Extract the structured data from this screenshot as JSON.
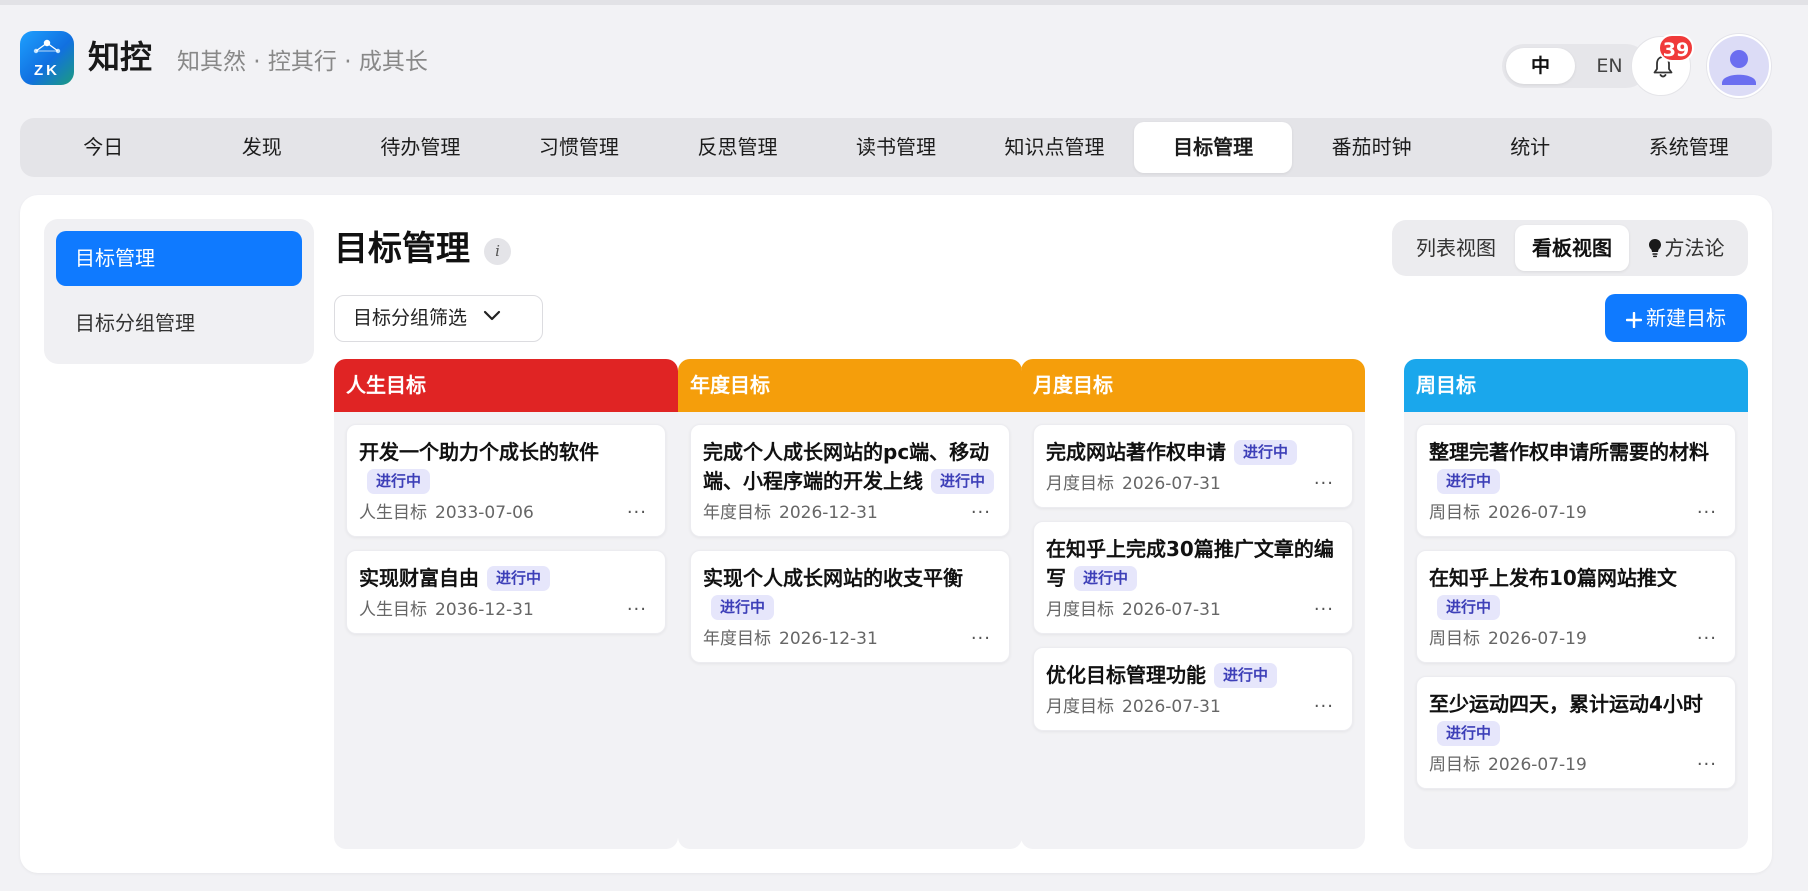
{
  "app": {
    "name": "知控",
    "logo_text": "ZK",
    "slogan": "知其然 · 控其行 · 成其长"
  },
  "header": {
    "lang_options": [
      "中",
      "EN"
    ],
    "lang_selected": "中",
    "notification_count": "39"
  },
  "nav": {
    "items": [
      "今日",
      "发现",
      "待办管理",
      "习惯管理",
      "反思管理",
      "读书管理",
      "知识点管理",
      "目标管理",
      "番茄时钟",
      "统计",
      "系统管理"
    ],
    "active": "目标管理"
  },
  "sidebar": {
    "items": [
      "目标管理",
      "目标分组管理"
    ],
    "active": "目标管理"
  },
  "main": {
    "title": "目标管理",
    "info_icon": "i",
    "views": [
      "列表视图",
      "看板视图",
      "方法论"
    ],
    "active_view": "看板视图",
    "filter_label": "目标分组筛选",
    "new_button": "新建目标"
  },
  "colors": {
    "primary": "#0f7aff",
    "life": "#e02424",
    "year": "#f59e0b",
    "month": "#f59e0b",
    "week": "#1aa7ec",
    "status_bg": "#e6e6fb",
    "status_text": "#3d3fb8",
    "badge": "#f03a3a"
  },
  "board": {
    "columns": [
      {
        "title": "人生目标",
        "cards": [
          {
            "title": "开发一个助力个成长的软件",
            "status": "进行中",
            "type": "人生目标",
            "date": "2033-07-06"
          },
          {
            "title": "实现财富自由",
            "status": "进行中",
            "type": "人生目标",
            "date": "2036-12-31"
          }
        ]
      },
      {
        "title": "年度目标",
        "cards": [
          {
            "title": "完成个人成长网站的pc端、移动端、小程序端的开发上线",
            "status": "进行中",
            "type": "年度目标",
            "date": "2026-12-31"
          },
          {
            "title": "实现个人成长网站的收支平衡",
            "status": "进行中",
            "type": "年度目标",
            "date": "2026-12-31"
          }
        ]
      },
      {
        "title": "月度目标",
        "cards": [
          {
            "title": "完成网站著作权申请",
            "status": "进行中",
            "type": "月度目标",
            "date": "2026-07-31"
          },
          {
            "title": "在知乎上完成30篇推广文章的编写",
            "status": "进行中",
            "type": "月度目标",
            "date": "2026-07-31"
          },
          {
            "title": "优化目标管理功能",
            "status": "进行中",
            "type": "月度目标",
            "date": "2026-07-31"
          }
        ]
      },
      {
        "title": "周目标",
        "cards": [
          {
            "title": "整理完著作权申请所需要的材料",
            "status": "进行中",
            "type": "周目标",
            "date": "2026-07-19"
          },
          {
            "title": "在知乎上发布10篇网站推文",
            "status": "进行中",
            "type": "周目标",
            "date": "2026-07-19"
          },
          {
            "title": "至少运动四天，累计运动4小时",
            "status": "进行中",
            "type": "周目标",
            "date": "2026-07-19"
          }
        ]
      }
    ],
    "more_icon": "···"
  }
}
